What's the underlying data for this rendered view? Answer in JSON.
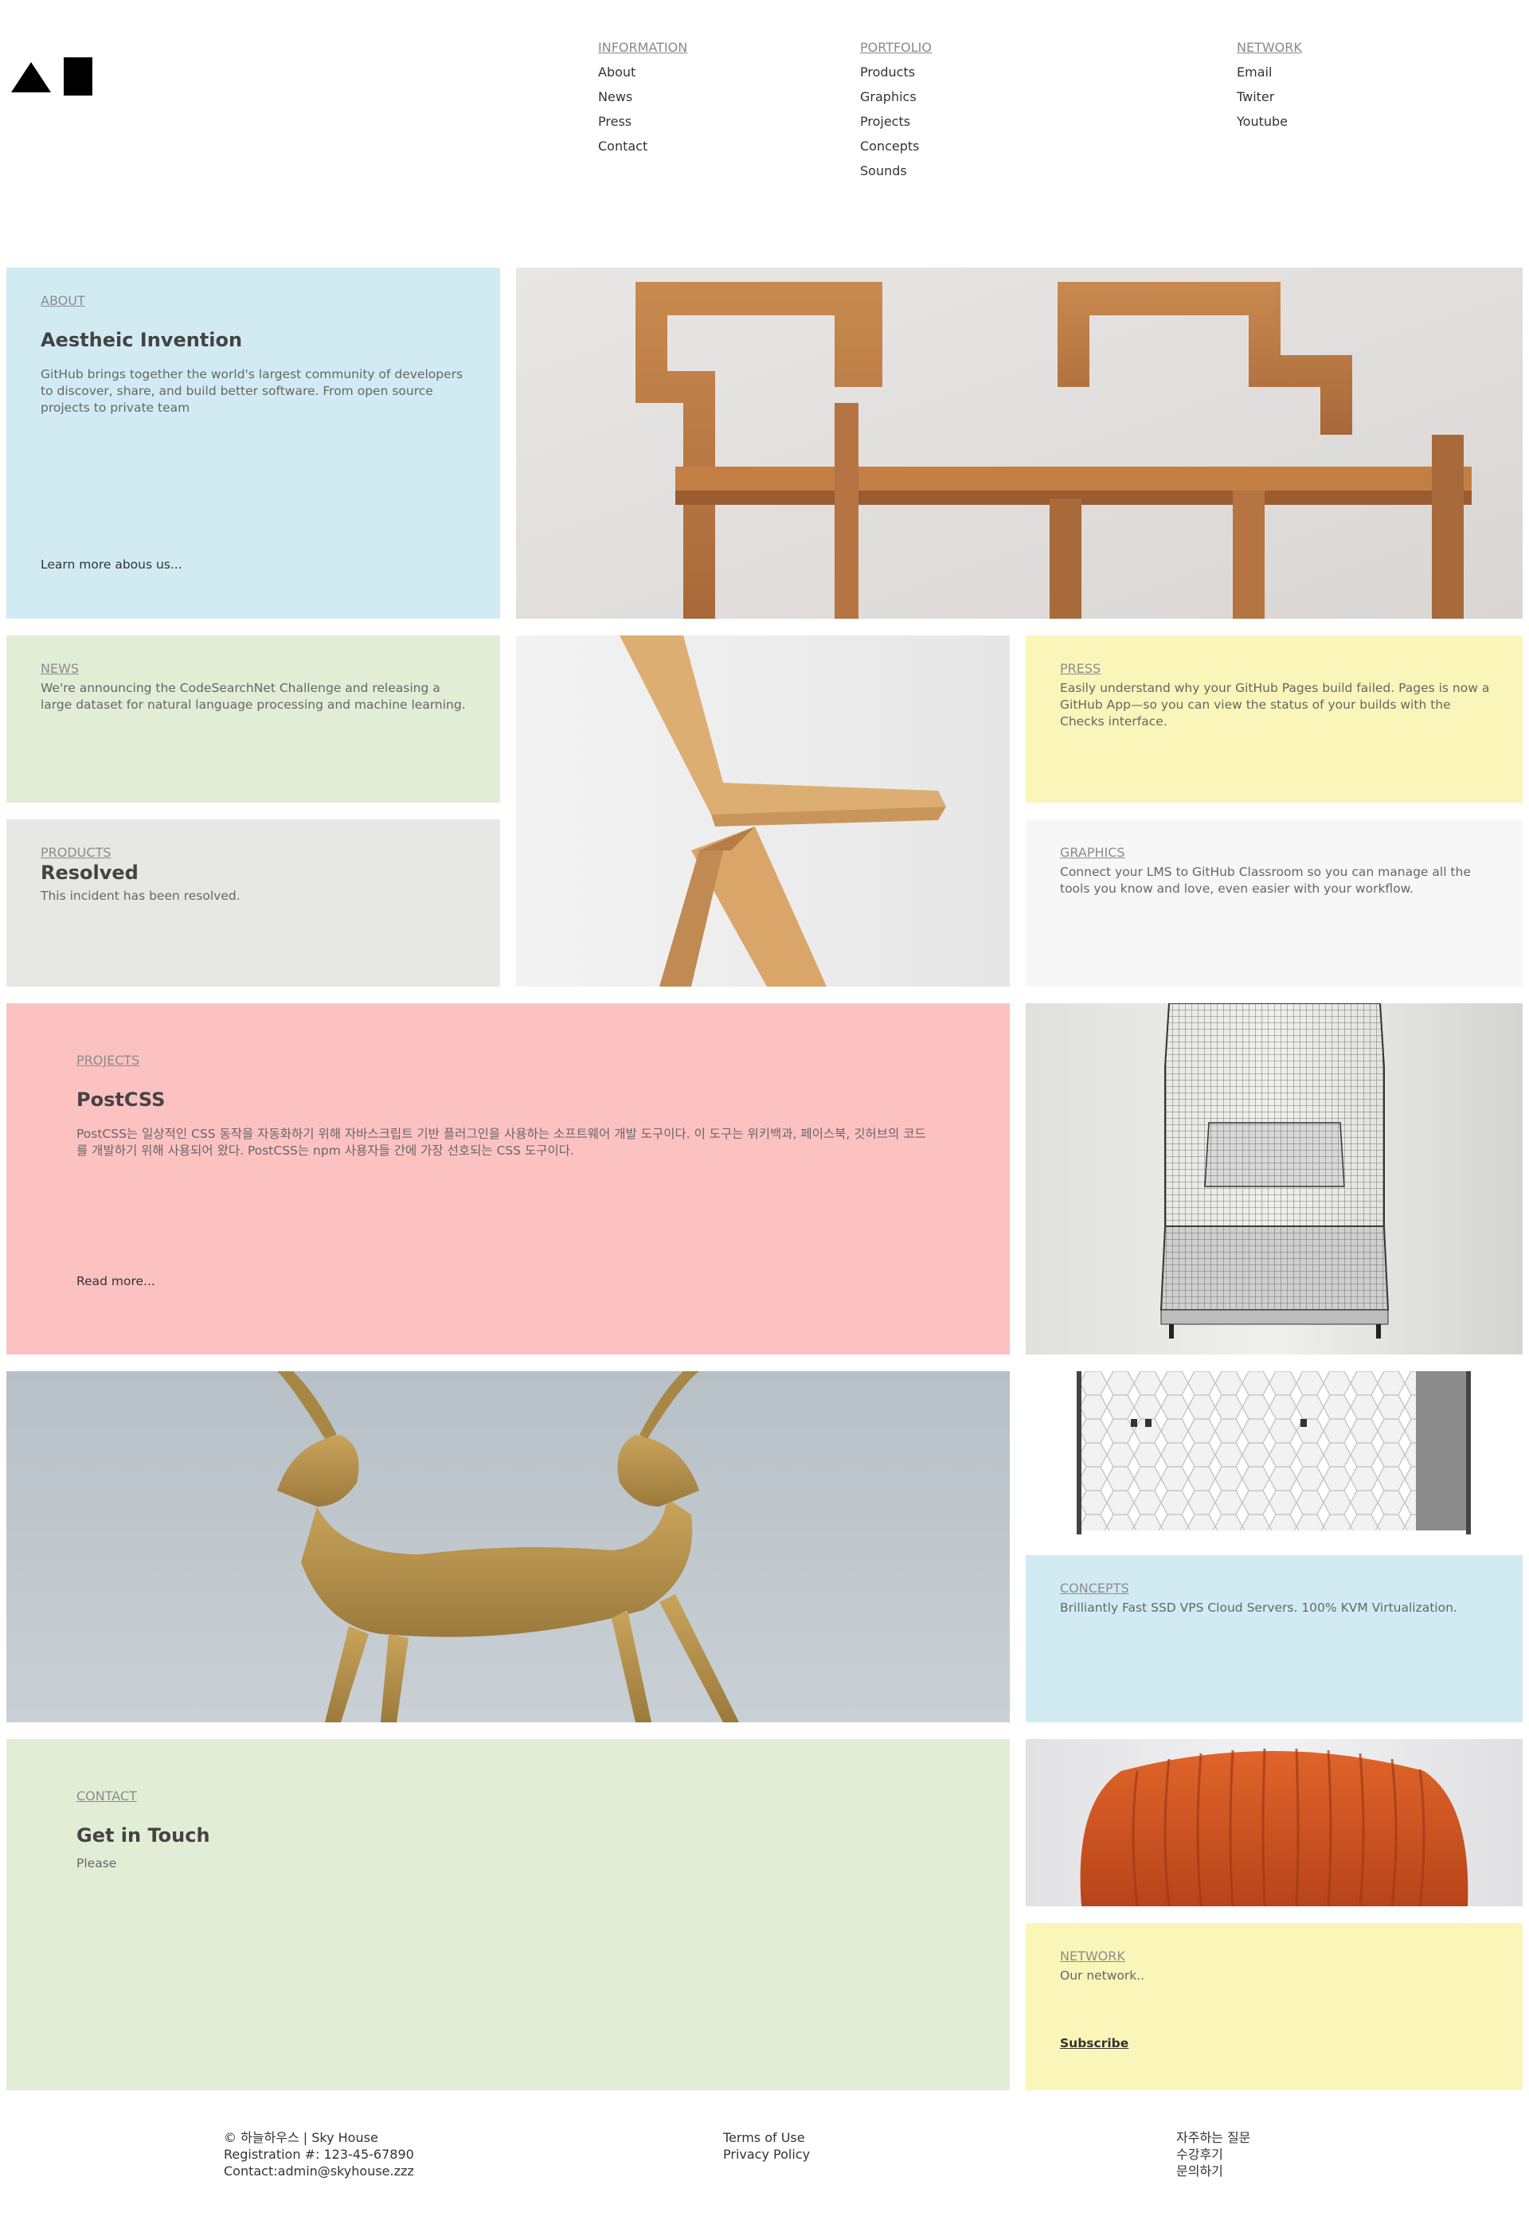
{
  "header": {
    "logo_icon": "triangle-square-logo-icon",
    "nav": [
      {
        "heading": "INFORMATION",
        "items": [
          "About",
          "News",
          "Press",
          "Contact"
        ]
      },
      {
        "heading": "PORTFOLIO",
        "items": [
          "Products",
          "Graphics",
          "Projects",
          "Concepts",
          "Sounds"
        ]
      },
      {
        "heading": "NETWORK",
        "items": [
          "Email",
          "Twiter",
          "Youtube"
        ]
      }
    ]
  },
  "tiles": {
    "about": {
      "label": "ABOUT",
      "title": "Aestheic Invention",
      "text": "GitHub brings together the world's largest community of developers to discover, share, and build better software. From open source projects to private team",
      "link": "Learn more abous us..."
    },
    "news": {
      "label": "NEWS",
      "text": "We're announcing the CodeSearchNet Challenge and releasing a large dataset for natural language processing and machine learning."
    },
    "products": {
      "label": "PRODUCTS",
      "title": "Resolved",
      "text": "This incident has been resolved."
    },
    "press": {
      "label": "PRESS",
      "text": "Easily understand why your GitHub Pages build failed. Pages is now a GitHub App—so you can view the status of your builds with the Checks interface."
    },
    "graphics": {
      "label": "GRAPHICS",
      "text": "Connect your LMS to GitHub Classroom so you can manage all the tools you know and love, even easier with your workflow."
    },
    "projects": {
      "label": "PROJECTS",
      "title": "PostCSS",
      "text": "PostCSS는 일상적인 CSS 동작을 자동화하기 위해 자바스크립트 기반 플러그인을 사용하는 소프트웨어 개발 도구이다. 이 도구는 위키백과, 페이스북, 깃허브의 코드를 개발하기 위해 사용되어 왔다. PostCSS는 npm 사용자들 간에 가장 선호되는 CSS 도구이다.",
      "link": "Read more..."
    },
    "concepts": {
      "label": "CONCEPTS",
      "text": "Brilliantly Fast SSD VPS Cloud Servers. 100% KVM Virtualization."
    },
    "contact": {
      "label": "CONTACT",
      "title": "Get in Touch",
      "text": "Please"
    },
    "network": {
      "label": "NETWORK",
      "text": "Our network..",
      "link": "Subscribe"
    }
  },
  "images": {
    "bench": "wooden-bench-image",
    "chair": "wooden-chair-image",
    "armchair": "wireframe-armchair-image",
    "deer": "golden-deer-sculpture-image",
    "cabinet": "white-cabinet-image",
    "sofa": "orange-armchair-image"
  },
  "colors": {
    "blue": "#d2ebf3",
    "green": "#e2edd6",
    "gray": "#e7e7e5",
    "yellow": "#faf6b9",
    "lightgray": "#f7f7f7",
    "pink": "#fcc2c1"
  },
  "footer": {
    "left": [
      "© 하늘하우스 | Sky House",
      "Registration #: 123-45-67890",
      "Contact:admin@skyhouse.zzz"
    ],
    "middle": [
      "Terms of Use",
      "Privacy Policy"
    ],
    "right": [
      "자주하는 질문",
      "수강후기",
      "문의하기"
    ]
  }
}
